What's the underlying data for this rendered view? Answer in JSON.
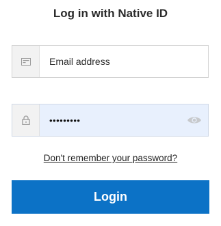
{
  "title": "Log in with Native ID",
  "email": {
    "value": "Email address",
    "icon": "id-card-icon"
  },
  "password": {
    "value": "•••••••••",
    "icon": "lock-icon",
    "toggle_icon": "eye-icon"
  },
  "forgot_link": "Don't remember your password?",
  "login_button": "Login",
  "colors": {
    "primary": "#0c72c6",
    "password_bg": "#e8f0fd"
  }
}
